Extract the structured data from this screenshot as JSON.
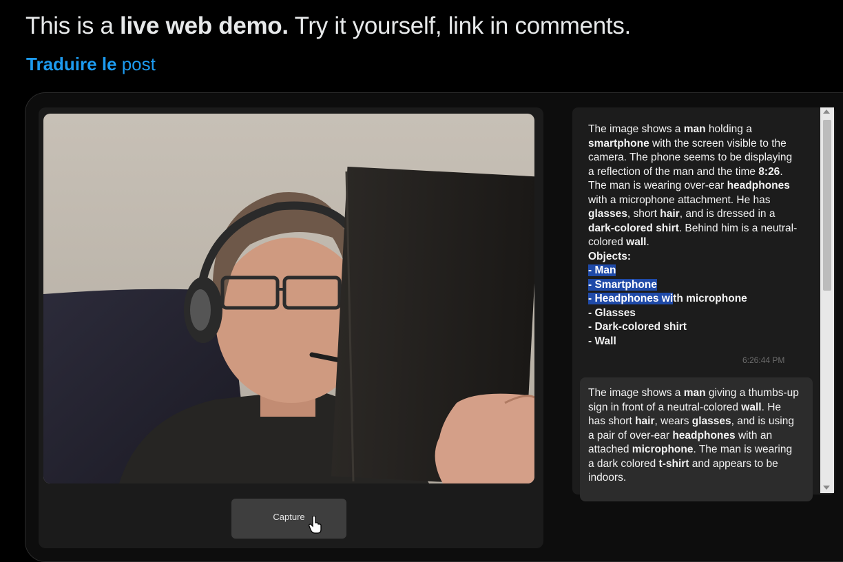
{
  "post": {
    "text_prefix": "This is a ",
    "text_bold": "live web demo.",
    "text_suffix": " Try it yourself, link in comments.",
    "translate_bold": "Traduire le",
    "translate_rest": " post"
  },
  "demo": {
    "capture_label": "Capture",
    "messages": [
      {
        "parts": [
          {
            "t": "The image shows a "
          },
          {
            "t": "man",
            "b": true
          },
          {
            "t": " holding a "
          },
          {
            "t": "smartphone",
            "b": true
          },
          {
            "t": " with the screen visible to the camera. The phone seems to be displaying a reflection of the man and the time "
          },
          {
            "t": "8:26",
            "b": true
          },
          {
            "t": ". The man is wearing over-ear "
          },
          {
            "t": "headphones",
            "b": true
          },
          {
            "t": " with a microphone attachment. He has "
          },
          {
            "t": "glasses",
            "b": true
          },
          {
            "t": ", short "
          },
          {
            "t": "hair",
            "b": true
          },
          {
            "t": ", and is dressed in a "
          },
          {
            "t": "dark-colored shirt",
            "b": true
          },
          {
            "t": ". Behind him is a neutral-colored "
          },
          {
            "t": "wall",
            "b": true
          },
          {
            "t": "."
          }
        ],
        "objects_heading": "Objects:",
        "objects": [
          [
            {
              "t": "- Man",
              "hl": true
            }
          ],
          [
            {
              "t": "- Smartphone",
              "hl": true
            }
          ],
          [
            {
              "t": "- Headphones wi",
              "hl": true
            },
            {
              "t": "th microphone"
            }
          ],
          [
            {
              "t": "- Glasses"
            }
          ],
          [
            {
              "t": "- Dark-colored shirt"
            }
          ],
          [
            {
              "t": "- Wall"
            }
          ]
        ],
        "time": "6:26:44 PM"
      },
      {
        "parts": [
          {
            "t": "The image shows a "
          },
          {
            "t": "man",
            "b": true
          },
          {
            "t": " giving a thumbs-up sign in front of a neutral-colored "
          },
          {
            "t": "wall",
            "b": true
          },
          {
            "t": ". He has short "
          },
          {
            "t": "hair",
            "b": true
          },
          {
            "t": ", wears "
          },
          {
            "t": "glasses",
            "b": true
          },
          {
            "t": ", and is using a pair of over-ear "
          },
          {
            "t": "headphones",
            "b": true
          },
          {
            "t": " with an attached "
          },
          {
            "t": "microphone",
            "b": true
          },
          {
            "t": ". The man is wearing a dark colored "
          },
          {
            "t": "t-shirt",
            "b": true
          },
          {
            "t": " and appears to be indoors."
          }
        ]
      }
    ]
  },
  "colors": {
    "link": "#1d9bf0",
    "highlight": "#1f4aa8",
    "background": "#000000"
  },
  "icons": {
    "cursor": "hand-pointer-icon"
  }
}
